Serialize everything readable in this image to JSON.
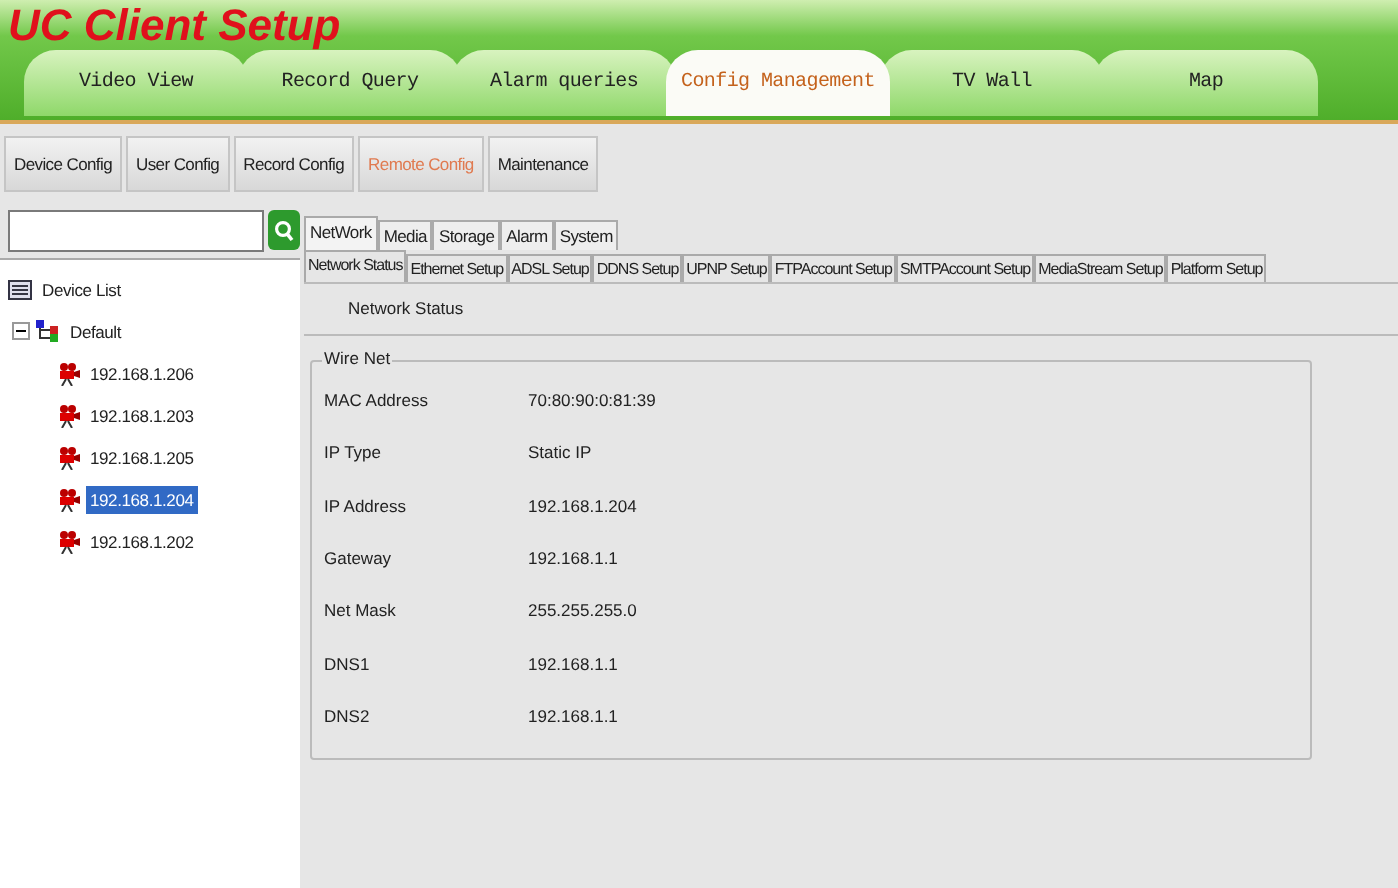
{
  "app_title": "UC Client Setup",
  "main_tabs": [
    {
      "label": "Video View",
      "selected": false
    },
    {
      "label": "Record Query",
      "selected": false
    },
    {
      "label": "Alarm queries",
      "selected": false
    },
    {
      "label": "Config Management",
      "selected": true
    },
    {
      "label": "TV Wall",
      "selected": false
    },
    {
      "label": "Map",
      "selected": false
    }
  ],
  "toolbar": [
    {
      "label": "Device Config",
      "selected": false
    },
    {
      "label": "User Config",
      "selected": false
    },
    {
      "label": "Record Config",
      "selected": false
    },
    {
      "label": "Remote Config",
      "selected": true
    },
    {
      "label": "Maintenance",
      "selected": false
    }
  ],
  "device_tree": {
    "label": "Device List",
    "children": [
      {
        "label": "Default",
        "expanded": true,
        "children": [
          {
            "label": "192.168.1.206",
            "selected": false
          },
          {
            "label": "192.168.1.203",
            "selected": false
          },
          {
            "label": "192.168.1.205",
            "selected": false
          },
          {
            "label": "192.168.1.204",
            "selected": true
          },
          {
            "label": "192.168.1.202",
            "selected": false
          }
        ]
      }
    ]
  },
  "config_tabs": [
    {
      "label": "NetWork",
      "selected": true
    },
    {
      "label": "Media",
      "selected": false
    },
    {
      "label": "Storage",
      "selected": false
    },
    {
      "label": "Alarm",
      "selected": false
    },
    {
      "label": "System",
      "selected": false
    }
  ],
  "network_tabs": [
    {
      "label": "Network Status",
      "selected": true
    },
    {
      "label": "Ethernet Setup",
      "selected": false
    },
    {
      "label": "ADSL Setup",
      "selected": false
    },
    {
      "label": "DDNS Setup",
      "selected": false
    },
    {
      "label": "UPNP Setup",
      "selected": false
    },
    {
      "label": "FTPAccount Setup",
      "selected": false
    },
    {
      "label": "SMTPAccount Setup",
      "selected": false
    },
    {
      "label": "MediaStream Setup",
      "selected": false
    },
    {
      "label": "Platform Setup",
      "selected": false
    }
  ],
  "section_title": "Network Status",
  "group": {
    "title": "Wire Net",
    "rows": [
      {
        "label": "MAC Address",
        "value": "70:80:90:0:81:39"
      },
      {
        "label": "IP Type",
        "value": "Static IP"
      },
      {
        "label": "IP Address",
        "value": "192.168.1.204"
      },
      {
        "label": "Gateway",
        "value": "192.168.1.1"
      },
      {
        "label": "Net Mask",
        "value": "255.255.255.0"
      },
      {
        "label": "DNS1",
        "value": "192.168.1.1"
      },
      {
        "label": "DNS2",
        "value": "192.168.1.1"
      }
    ]
  }
}
